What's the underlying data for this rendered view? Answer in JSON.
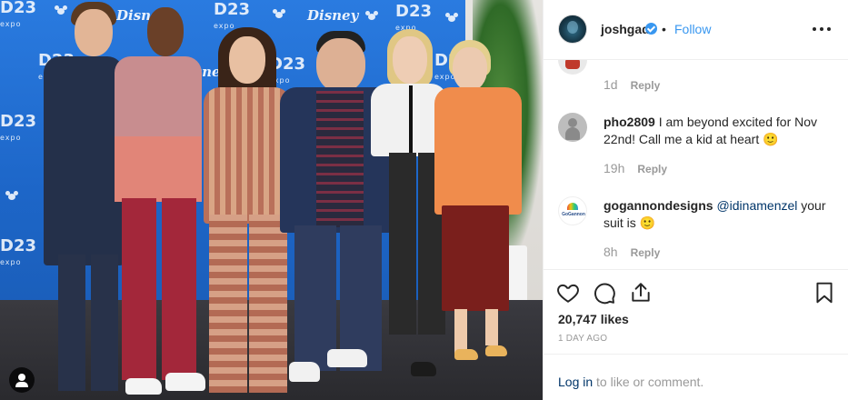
{
  "post": {
    "username": "joshgad",
    "follow_label": "Follow",
    "separator": "•",
    "likes": "20,747 likes",
    "age": "1 DAY AGO"
  },
  "comments": [
    {
      "username": "",
      "text": "",
      "time": "1d",
      "reply": "Reply"
    },
    {
      "username": "pho2809",
      "text": " I am beyond excited for Nov 22nd! Call me a kid at heart 🙂",
      "time": "19h",
      "reply": "Reply"
    },
    {
      "username": "gogannondesigns",
      "mention": "@idinamenzel",
      "text": " your suit is 🙂",
      "time": "8h",
      "reply": "Reply"
    }
  ],
  "avatar_text": {
    "gogannon": "GoGannon"
  },
  "photo": {
    "backdrop_logos": [
      "D23",
      "expo",
      "Disney"
    ],
    "logo_sub": "EXPO"
  },
  "login": {
    "link": "Log in",
    "rest": " to like or comment."
  },
  "icons": {
    "like": "heart-icon",
    "comment": "speech-bubble-icon",
    "share": "share-icon",
    "save": "bookmark-icon",
    "more": "more-options-icon",
    "verified": "verified-badge-icon",
    "user_tag": "user-tag-icon"
  },
  "colors": {
    "accent": "#3897f0",
    "link": "#003569",
    "muted": "#999999",
    "backdrop": "#1f6fd1"
  }
}
